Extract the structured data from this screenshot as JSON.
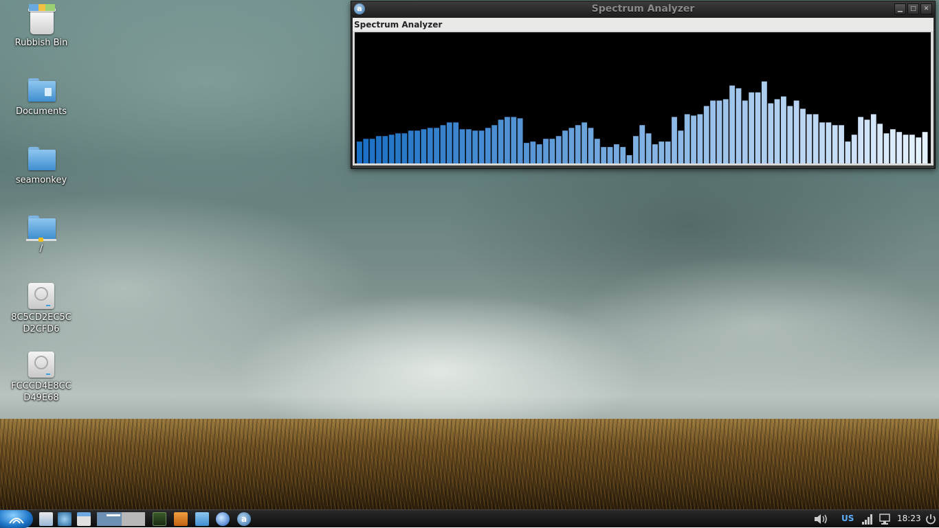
{
  "desktop": {
    "icons": [
      {
        "label": "Rubbish Bin",
        "icon": "trash-icon"
      },
      {
        "label": "Documents",
        "icon": "folder-documents-icon"
      },
      {
        "label": "seamonkey",
        "icon": "folder-icon"
      },
      {
        "label": "/",
        "icon": "root-folder-icon"
      },
      {
        "label": "8C5CD2EC5CD2CFD6",
        "icon": "drive-icon"
      },
      {
        "label": "FCCCD4E8CCD49E68",
        "icon": "drive-icon"
      }
    ]
  },
  "window": {
    "title": "Spectrum Analyzer",
    "header": "Spectrum Analyzer",
    "controls": {
      "minimize": "▁",
      "maximize": "□",
      "close": "✕"
    }
  },
  "chart_data": {
    "type": "bar",
    "title": "",
    "xlabel": "",
    "ylabel": "",
    "ylim": [
      0,
      190
    ],
    "gradient": [
      "#1a6fc4",
      "#e6f2ff"
    ],
    "values": [
      32,
      36,
      36,
      40,
      40,
      42,
      44,
      44,
      48,
      48,
      50,
      52,
      52,
      56,
      60,
      60,
      50,
      50,
      48,
      48,
      52,
      56,
      64,
      68,
      68,
      66,
      30,
      32,
      28,
      36,
      36,
      40,
      48,
      52,
      56,
      60,
      52,
      36,
      24,
      24,
      28,
      24,
      12,
      40,
      56,
      44,
      28,
      32,
      32,
      68,
      48,
      72,
      70,
      72,
      84,
      92,
      92,
      94,
      114,
      110,
      92,
      104,
      104,
      120,
      88,
      94,
      98,
      84,
      92,
      80,
      72,
      72,
      60,
      60,
      56,
      56,
      32,
      42,
      68,
      64,
      72,
      58,
      44,
      50,
      46,
      42,
      42,
      38,
      46
    ]
  },
  "taskbar": {
    "language": "US",
    "clock": "18:23",
    "launchers": [
      "file-manager-icon",
      "network-icon",
      "window-icon",
      "workspace-switcher",
      "terminal-icon",
      "archive-icon",
      "folder-icon",
      "browser-icon",
      "audacious-icon"
    ],
    "tray": [
      "volume-icon",
      "signal-icon",
      "monitor-icon",
      "power-icon"
    ]
  }
}
